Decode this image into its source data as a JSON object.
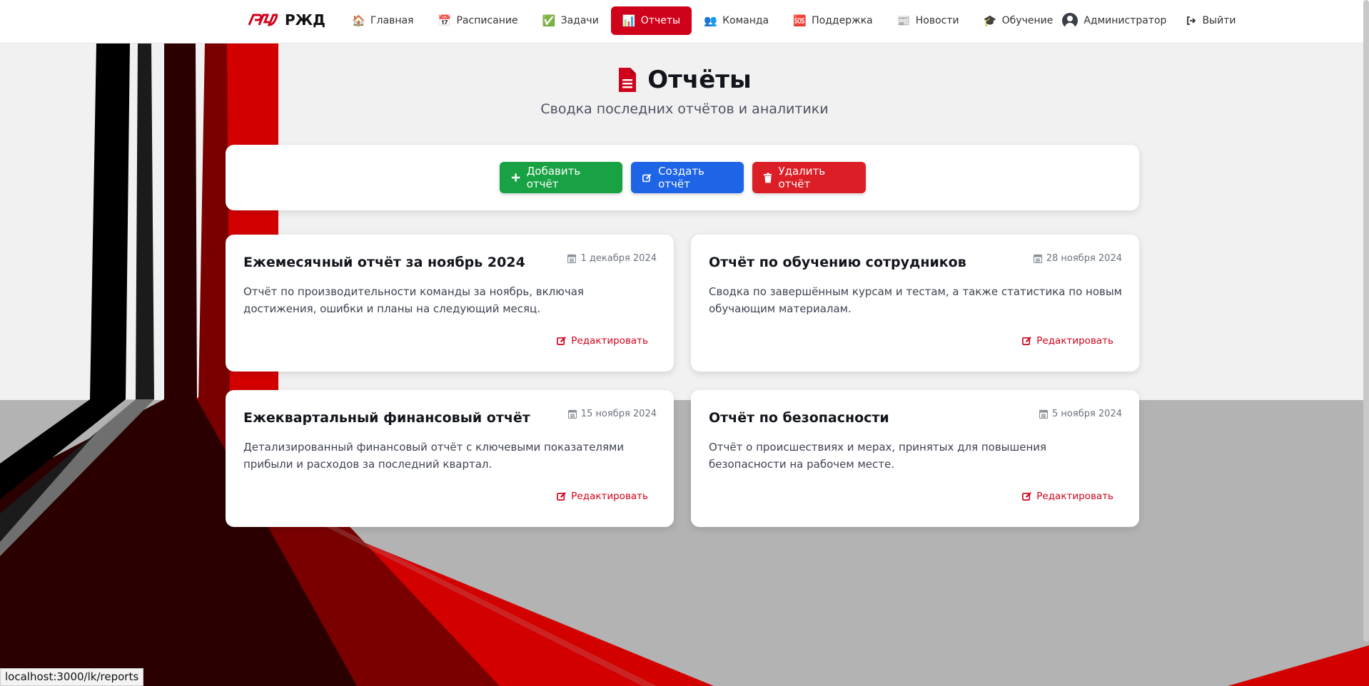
{
  "brand": {
    "name": "РЖД"
  },
  "nav": [
    {
      "label": "Главная",
      "icon": "🏠"
    },
    {
      "label": "Расписание",
      "icon": "📅"
    },
    {
      "label": "Задачи",
      "icon": "✅"
    },
    {
      "label": "Отчеты",
      "icon": "📊"
    },
    {
      "label": "Команда",
      "icon": "👥"
    },
    {
      "label": "Поддержка",
      "icon": "🆘"
    },
    {
      "label": "Новости",
      "icon": "📰"
    },
    {
      "label": "Обучение",
      "icon": "🎓"
    },
    {
      "label": "Администратор",
      "icon": "user-circle-icon"
    },
    {
      "label": "Выйти",
      "icon": "sign-out-icon"
    }
  ],
  "header": {
    "title": "Отчёты",
    "subtitle": "Сводка последних отчётов и аналитики"
  },
  "toolbar": {
    "add_label": "Добавить отчёт",
    "create_label": "Создать отчёт",
    "delete_label": "Удалить отчёт"
  },
  "reports": [
    {
      "title": "Ежемесячный отчёт за ноябрь 2024",
      "date": "1 декабря 2024",
      "description": "Отчёт по производительности команды за ноябрь, включая достижения, ошибки и планы на следующий месяц.",
      "edit_label": "Редактировать"
    },
    {
      "title": "Отчёт по обучению сотрудников",
      "date": "28 ноября 2024",
      "description": "Сводка по завершённым курсам и тестам, а также статистика по новым обучающим материалам.",
      "edit_label": "Редактировать"
    },
    {
      "title": "Ежеквартальный финансовый отчёт",
      "date": "15 ноября 2024",
      "description": "Детализированный финансовый отчёт с ключевыми показателями прибыли и расходов за последний квартал.",
      "edit_label": "Редактировать"
    },
    {
      "title": "Отчёт по безопасности",
      "date": "5 ноября 2024",
      "description": "Отчёт о происшествиях и мерах, принятых для повышения безопасности на рабочем месте.",
      "edit_label": "Редактировать"
    }
  ],
  "status_bar": {
    "url": "localhost:3000/lk/reports"
  },
  "colors": {
    "brand_red": "#d0021b",
    "green": "#18a244",
    "blue": "#1d64e6",
    "red": "#dc1f26"
  }
}
